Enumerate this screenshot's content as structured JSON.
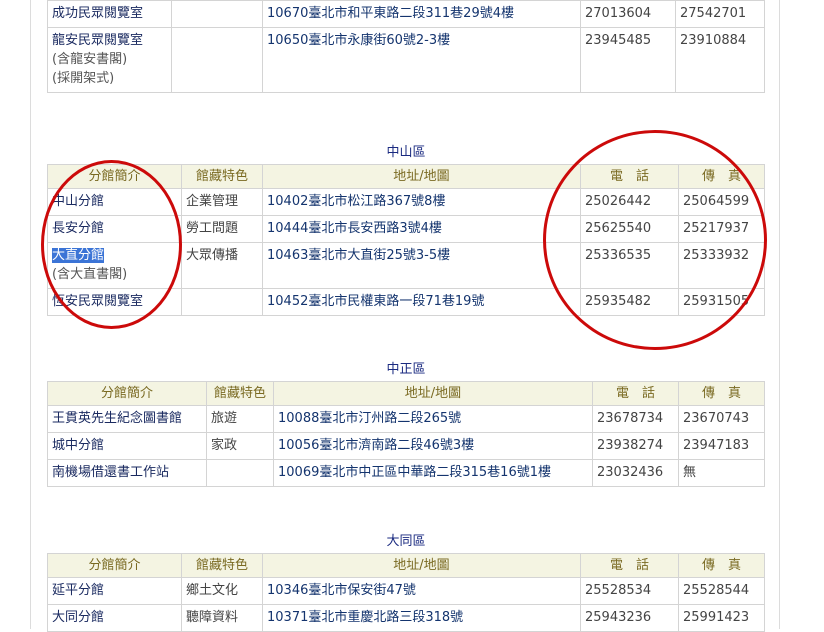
{
  "top_table": {
    "rows": [
      {
        "name": "",
        "sub": [],
        "feature": "",
        "address": "",
        "phone": "",
        "fax": "",
        "partial": true
      },
      {
        "name": "成功民眾閱覽室",
        "sub": [],
        "feature": "",
        "address": "10670臺北市和平東路二段311巷29號4樓",
        "phone": "27013604",
        "fax": "27542701"
      },
      {
        "name": "龍安民眾閱覽室",
        "sub": [
          "(含龍安書閣)",
          "(採開架式)"
        ],
        "feature": "",
        "address": "10650臺北市永康街60號2-3樓",
        "phone": "23945485",
        "fax": "23910884"
      }
    ]
  },
  "zhongshan": {
    "title": "中山區",
    "headers": [
      "分館簡介",
      "館藏特色",
      "地址/地圖",
      "電　話",
      "傳　真"
    ],
    "rows": [
      {
        "name": "中山分館",
        "sub": [],
        "feature": "企業管理",
        "address": "10402臺北市松江路367號8樓",
        "phone": "25026442",
        "fax": "25064599"
      },
      {
        "name": "長安分館",
        "sub": [],
        "feature": "勞工問題",
        "address": "10444臺北市長安西路3號4樓",
        "phone": "25625540",
        "fax": "25217937"
      },
      {
        "name": "大直分館",
        "sub": [
          "(含大直書閣)"
        ],
        "feature": "大眾傳播",
        "address": "10463臺北市大直街25號3-5樓",
        "phone": "25336535",
        "fax": "25333932",
        "highlight": true
      },
      {
        "name": "恆安民眾閱覽室",
        "sub": [],
        "feature": "",
        "address": "10452臺北市民權東路一段71巷19號",
        "phone": "25935482",
        "fax": "25931505"
      }
    ]
  },
  "zhongzheng": {
    "title": "中正區",
    "headers": [
      "分館簡介",
      "館藏特色",
      "地址/地圖",
      "電　話",
      "傳　真"
    ],
    "rows": [
      {
        "name": "王貫英先生紀念圖書館",
        "sub": [],
        "feature": "旅遊",
        "address": "10088臺北市汀州路二段265號",
        "phone": "23678734",
        "fax": "23670743"
      },
      {
        "name": "城中分館",
        "sub": [],
        "feature": "家政",
        "address": "10056臺北市濟南路二段46號3樓",
        "phone": "23938274",
        "fax": "23947183"
      },
      {
        "name": "南機場借還書工作站",
        "sub": [],
        "feature": "",
        "address": "10069臺北市中正區中華路二段315巷16號1樓",
        "phone": "23032436",
        "fax": "無"
      }
    ]
  },
  "datong": {
    "title": "大同區",
    "headers": [
      "分館簡介",
      "館藏特色",
      "地址/地圖",
      "電　話",
      "傳　真"
    ],
    "rows": [
      {
        "name": "延平分館",
        "sub": [],
        "feature": "鄉土文化",
        "address": "10346臺北市保安街47號",
        "phone": "25528534",
        "fax": "25528544"
      },
      {
        "name": "大同分館",
        "sub": [],
        "feature": "聽障資料",
        "address": "10371臺北市重慶北路三段318號",
        "phone": "25943236",
        "fax": "25991423"
      }
    ]
  },
  "colors": {
    "annotation": "#cc0a0a",
    "header_bg": "#f4f4e2",
    "header_text": "#7a6a22",
    "district_title": "#1a2a80",
    "link": "#14346e",
    "selection": "#3b74d6"
  }
}
